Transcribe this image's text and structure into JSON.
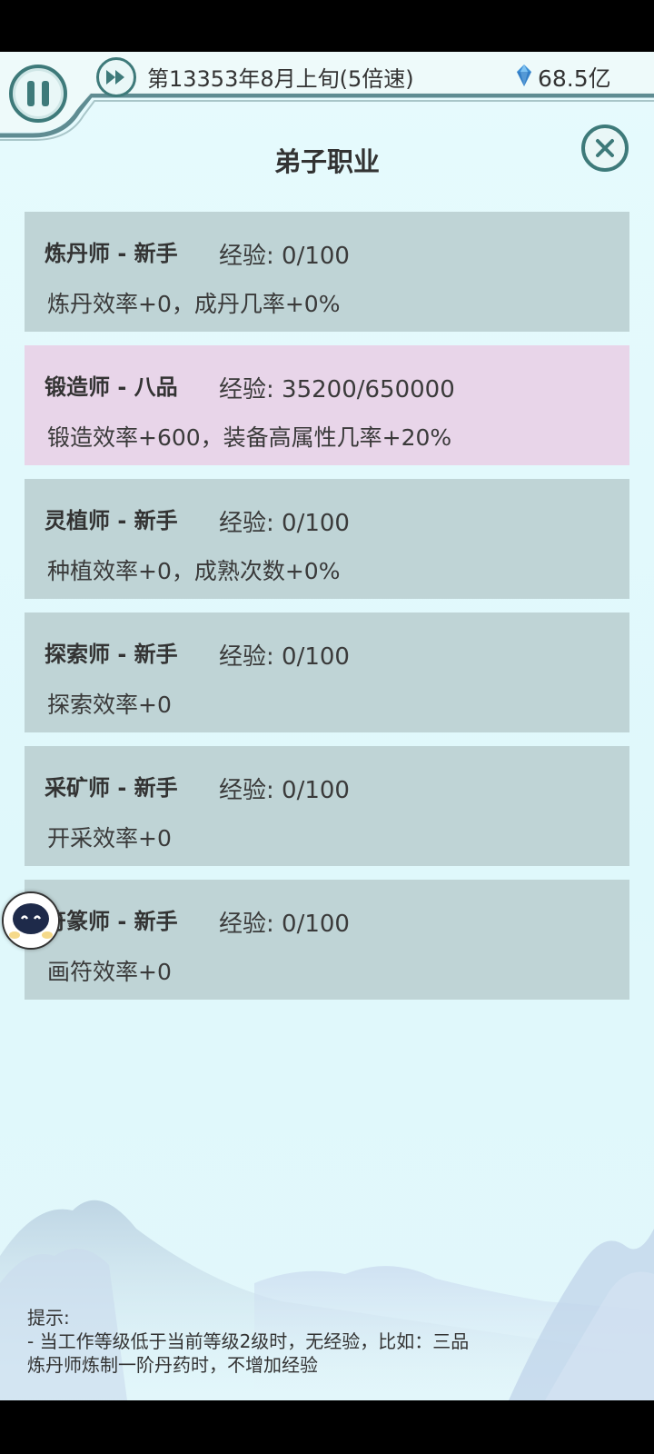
{
  "header": {
    "date_text": "第13353年8月上旬(5倍速)",
    "spirit_stones": "68.5亿"
  },
  "page": {
    "title": "弟子职业"
  },
  "professions": [
    {
      "job": "炼丹师 - 新手",
      "exp": "经验: 0/100",
      "desc": "炼丹效率+0，成丹几率+0%",
      "highlight": false
    },
    {
      "job": "锻造师 - 八品",
      "exp": "经验: 35200/650000",
      "desc": "锻造效率+600，装备高属性几率+20%",
      "highlight": true
    },
    {
      "job": "灵植师 - 新手",
      "exp": "经验: 0/100",
      "desc": "种植效率+0，成熟次数+0%",
      "highlight": false
    },
    {
      "job": "探索师 - 新手",
      "exp": "经验: 0/100",
      "desc": "探索效率+0",
      "highlight": false
    },
    {
      "job": "采矿师 - 新手",
      "exp": "经验: 0/100",
      "desc": "开采效率+0",
      "highlight": false
    },
    {
      "job": "符篆师 - 新手",
      "exp": "经验: 0/100",
      "desc": "画符效率+0",
      "highlight": false
    }
  ],
  "tips": {
    "heading": "提示:",
    "line1": "- 当工作等级低于当前等级2级时，无经验，比如：三品",
    "line2": "炼丹师炼制一阶丹药时，不增加经验"
  },
  "icons": {
    "pause": "pause-icon",
    "fast_forward": "fast-forward-icon",
    "gem": "spirit-stone-icon",
    "close": "close-icon",
    "avatar": "assistant-avatar-icon"
  },
  "colors": {
    "accent": "#3e7a7a",
    "card_default": "#bfd4d6",
    "card_highlight": "#e8d5e9",
    "background": "#e2f7fb"
  }
}
